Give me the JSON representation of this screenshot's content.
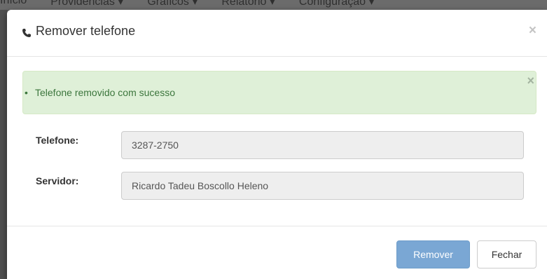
{
  "background_nav": {
    "items": [
      "Início",
      "Providências ▾",
      "Gráficos ▾",
      "Relatório ▾",
      "Configuração ▾"
    ]
  },
  "modal": {
    "title": "Remover telefone",
    "title_icon": "phone-icon",
    "close_glyph": "×"
  },
  "alert": {
    "messages": [
      "Telefone removido com sucesso"
    ],
    "close_glyph": "×",
    "color": "#3c763d",
    "background": "#dff0d8"
  },
  "form": {
    "telefone": {
      "label": "Telefone:",
      "value": "3287-2750"
    },
    "servidor": {
      "label": "Servidor:",
      "value": "Ricardo Tadeu Boscollo Heleno"
    }
  },
  "footer": {
    "remove_label": "Remover",
    "close_label": "Fechar",
    "primary_color": "#7aa7d4"
  }
}
